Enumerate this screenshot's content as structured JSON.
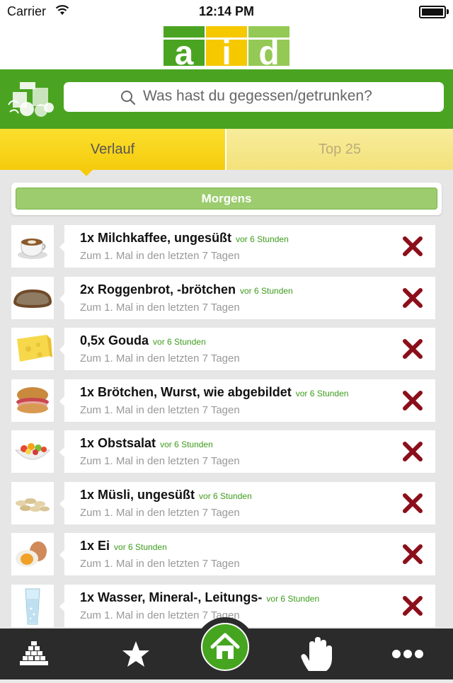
{
  "status_bar": {
    "carrier": "Carrier",
    "time": "12:14 PM"
  },
  "logo": {
    "letters": [
      "a",
      "i",
      "d"
    ]
  },
  "search": {
    "placeholder": "Was hast du gegessen/getrunken?"
  },
  "tabs": [
    {
      "label": "Verlauf",
      "active": true
    },
    {
      "label": "Top 25",
      "active": false
    }
  ],
  "section": {
    "title": "Morgens"
  },
  "items": [
    {
      "title": "1x Milchkaffee, ungesüßt",
      "time": "vor 6 Stunden",
      "subtitle": "Zum 1. Mal in den letzten 7 Tagen",
      "icon": "coffee-cup-icon"
    },
    {
      "title": "2x Roggenbrot, -brötchen",
      "time": "vor 6 Stunden",
      "subtitle": "Zum 1. Mal in den letzten 7 Tagen",
      "icon": "bread-icon"
    },
    {
      "title": "0,5x Gouda",
      "time": "vor 6 Stunden",
      "subtitle": "Zum 1. Mal in den letzten 7 Tagen",
      "icon": "cheese-icon"
    },
    {
      "title": "1x Brötchen, Wurst, wie abgebildet",
      "time": "vor 6 Stunden",
      "subtitle": "Zum 1. Mal in den letzten 7 Tagen",
      "icon": "sandwich-icon"
    },
    {
      "title": "1x Obstsalat",
      "time": "vor 6 Stunden",
      "subtitle": "Zum 1. Mal in den letzten 7 Tagen",
      "icon": "fruit-salad-icon"
    },
    {
      "title": "1x Müsli, ungesüßt",
      "time": "vor 6 Stunden",
      "subtitle": "Zum 1. Mal in den letzten 7 Tagen",
      "icon": "oat-flakes-icon"
    },
    {
      "title": "1x Ei",
      "time": "vor 6 Stunden",
      "subtitle": "Zum 1. Mal in den letzten 7 Tagen",
      "icon": "egg-icon"
    },
    {
      "title": "1x Wasser, Mineral-, Leitungs-",
      "time": "vor 6 Stunden",
      "subtitle": "Zum 1. Mal in den letzten 7 Tagen",
      "icon": "water-glass-icon"
    }
  ],
  "tab_bar": [
    "pyramid-icon",
    "star-icon",
    "home-icon",
    "hand-icon",
    "more-icon"
  ],
  "colors": {
    "brand_green": "#4aa421",
    "tab_yellow": "#f5cb0c",
    "delete_red": "#8b0f1a"
  }
}
